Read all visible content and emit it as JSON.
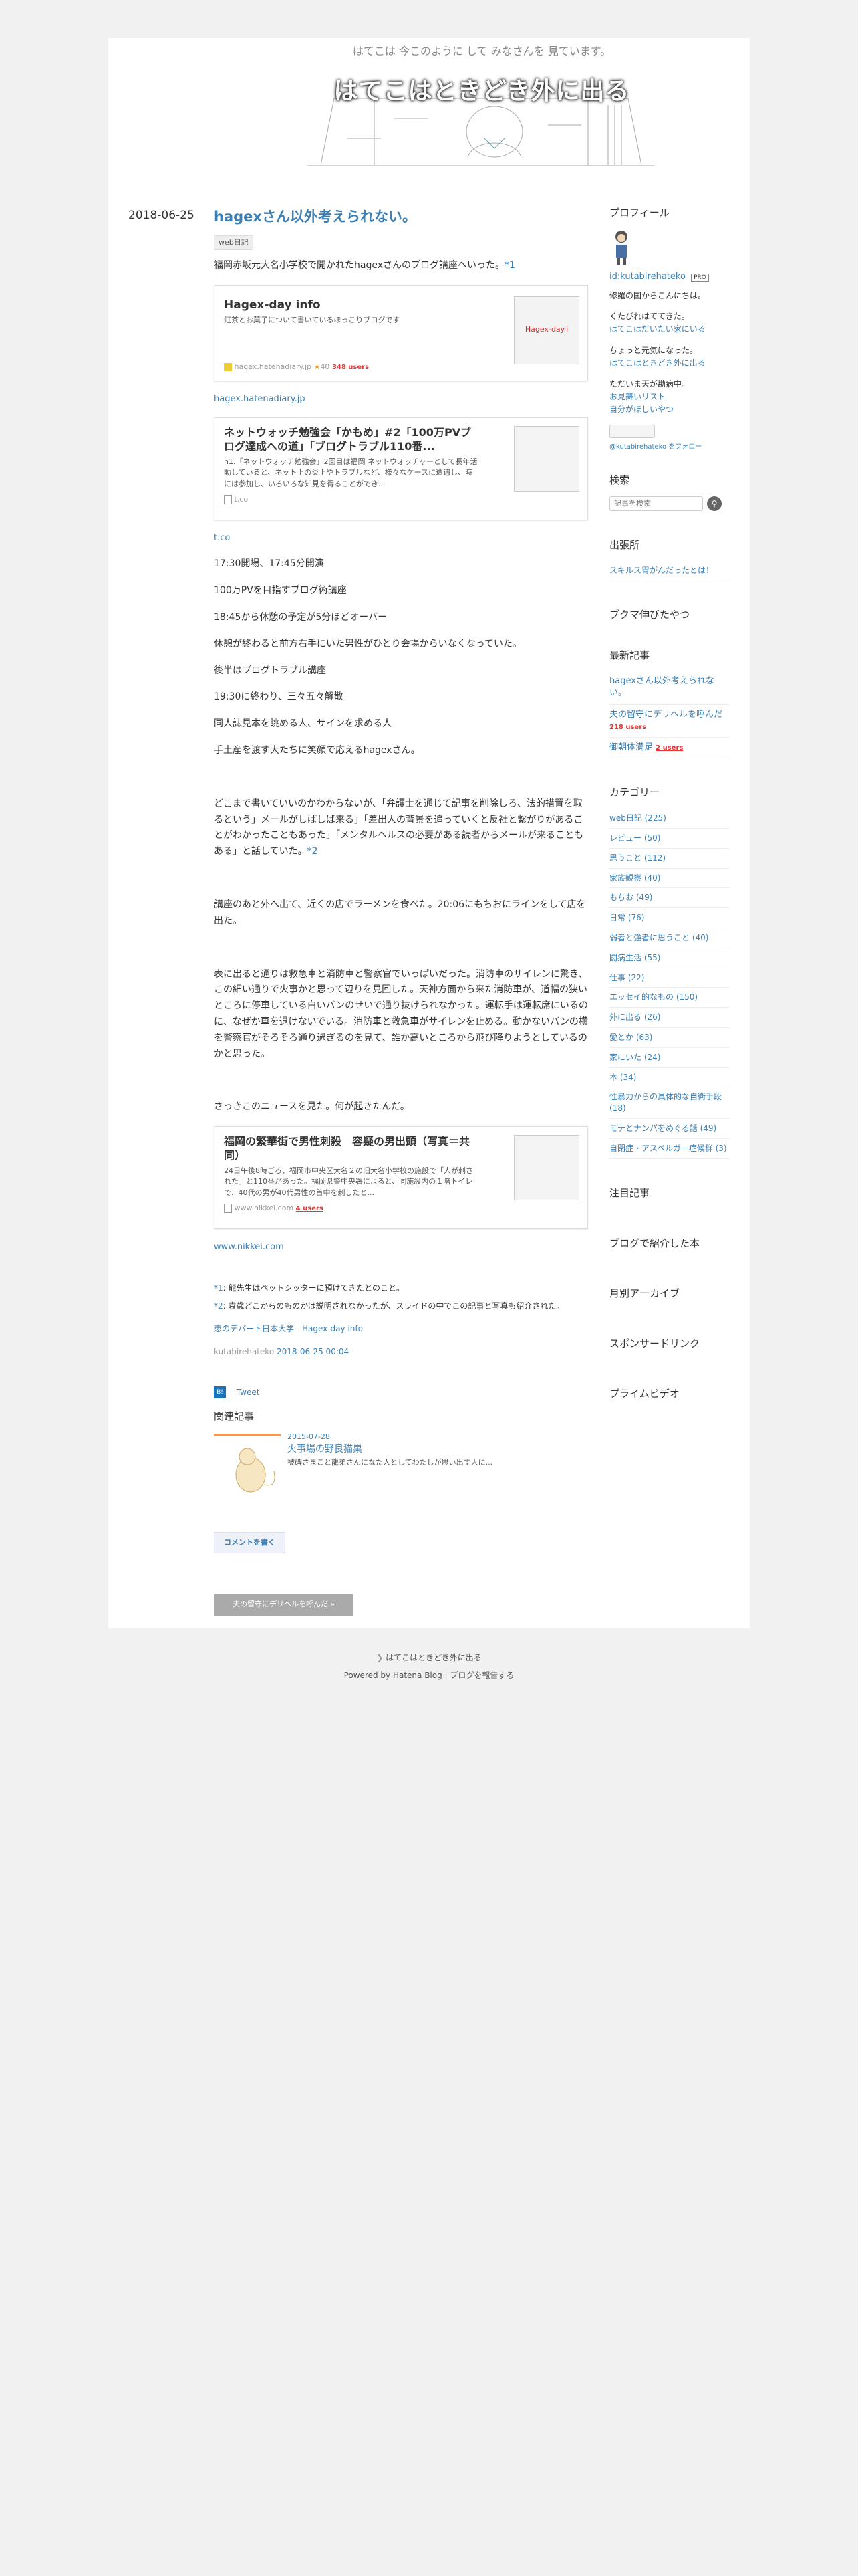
{
  "blog": {
    "title": "はてこはときどき外に出る",
    "tagline": "はてこは 今このように して みなさんを 見ています。"
  },
  "entry": {
    "date": "2018-06-25",
    "title": "hagexさん以外考えられない。",
    "tag": "web日記",
    "intro": "福岡赤坂元大名小学校で開かれたhagexさんのブログ講座へいった。",
    "fn1_mark": "*1",
    "card1": {
      "title": "Hagex-day info",
      "desc": "虹茶とお菓子について書いているほっこりブログです",
      "thumb_label": "Hagex-day.i",
      "meta_site": "hagex.hatenadiary.jp",
      "meta_count": "40",
      "users": "348 users"
    },
    "card1_link": "hagex.hatenadiary.jp",
    "card2": {
      "title": "ネットウォッチ勉強会「かもめ」#2「100万PVブログ達成への道」「ブログトラブル110番...",
      "desc": "h1.「ネットウォッチ勉強会」2回目は福岡 ネットウォッチャーとして長年活動していると、ネット上の炎上やトラブルなど、様々なケースに遭遇し、時には参加し、いろいろな知見を得ることができ...",
      "meta_site": "t.co"
    },
    "card2_link": "t.co",
    "schedule": [
      "17:30開場、17:45分開演",
      "100万PVを目指すブログ術講座",
      "18:45から休憩の予定が5分ほどオーバー",
      "休憩が終わると前方右手にいた男性がひとり会場からいなくなっていた。",
      "後半はブログトラブル講座",
      "19:30に終わり、三々五々解散",
      "同人誌見本を眺める人、サインを求める人",
      "手土産を渡す大たちに笑顔で応えるhagexさん。"
    ],
    "para2": "どこまで書いていいのかわからないが、「弁護士を通じて記事を削除しろ、法的措置を取るという」メールがしばしば来る」「差出人の背景を追っていくと反社と繋がりがあることがわかったこともあった」「メンタルヘルスの必要がある読者からメールが来ることもある」と話していた。",
    "fn2_mark": "*2",
    "para3": "講座のあと外へ出て、近くの店でラーメンを食べた。20:06にもちおにラインをして店を出た。",
    "para4": "表に出ると通りは救急車と消防車と警察官でいっぱいだった。消防車のサイレンに驚き、この細い通りで火事かと思って辺りを見回した。天神方面から来た消防車が、道幅の狭いところに停車している白いバンのせいで通り抜けられなかった。運転手は運転席にいるのに、なぜか車を退けないでいる。消防車と救急車がサイレンを止める。動かないバンの横を警察官がそろそろ通り過ぎるのを見て、誰か高いところから飛び降りようとしているのかと思った。",
    "para5": "さっきこのニュースを見た。何が起きたんだ。",
    "card3": {
      "title": "福岡の繁華街で男性刺殺　容疑の男出頭（写真＝共同）",
      "desc": "24日午後8時ごろ、福岡市中央区大名２の旧大名小学校の施設で「人が刺された」と110番があった。福岡県警中央署によると、同施設内の１階トイレで、40代の男が40代男性の首中を刺したと...",
      "meta_site": "www.nikkei.com",
      "users": "4 users"
    },
    "card3_link": "www.nikkei.com",
    "footnotes": [
      {
        "mark": "*1",
        "text": ": 龍先生はペットシッターに預けてきたとのこと。"
      },
      {
        "mark": "*2",
        "text": ": 袁歳どこからのものかは説明されなかったが、スライドの中でこの記事と写真も紹介された。"
      }
    ],
    "quote_source": "恵のデパート日本大学 - Hagex-day info",
    "author": "kutabirehateko",
    "timestamp": "2018-06-25 00:04",
    "tweet": "Tweet",
    "related_heading": "関連記事",
    "related": {
      "date": "2015-07-28",
      "title": "火事場の野良猫巣",
      "desc": "被碑さまこと龍弟さんになた人としてわたしが思い出す人に..."
    },
    "comment_button": "コメントを書く",
    "pager_label": "夫の留守にデリヘルを呼んだ »"
  },
  "sidebar": {
    "profile": {
      "title": "プロフィール",
      "id": "id:kutabirehateko",
      "pro": "PRO",
      "lines": [
        "修羅の国からこんにちは。",
        "くたびれはててきた。"
      ],
      "link1": "はてこはだいたい家にいる",
      "line3": "ちょっと元気になった。",
      "link2": "はてこはときどき外に出る",
      "line4": "ただいま天が勘病中。",
      "link3": "お見舞いリスト",
      "link4": "自分がほしいやつ",
      "follow": "@kutabirehateko をフォロー"
    },
    "search": {
      "title": "検索",
      "placeholder": "記事を検索"
    },
    "belong": {
      "title": "出張所",
      "link": "スキルス胃がんだったとは！"
    },
    "bukuma": {
      "title": "ブクマ伸びたやつ"
    },
    "recent": {
      "title": "最新記事",
      "items": [
        {
          "label": "hagexさん以外考えられない。",
          "users": ""
        },
        {
          "label": "夫の留守にデリヘルを呼んだ",
          "users": "218 users"
        },
        {
          "label": "御朝体満足",
          "users": "2 users"
        }
      ]
    },
    "categories": {
      "title": "カテゴリー",
      "items": [
        "web日記 (225)",
        "レビュー (50)",
        "思うこと (112)",
        "家族観察 (40)",
        "もちお (49)",
        "日常 (76)",
        "弱者と強者に思うこと (40)",
        "闘病生活 (55)",
        "仕事 (22)",
        "エッセイ的なもの (150)",
        "外に出る (26)",
        "愛とか (63)",
        "家にいた (24)",
        "本 (34)",
        "性暴力からの具体的な自衛手段 (18)",
        "モテとナンパをめぐる話 (49)",
        "自閉症・アスペルガー症候群 (3)"
      ]
    },
    "chumoku": {
      "title": "注目記事"
    },
    "introduced": {
      "title": "ブログで紹介した本"
    },
    "archive": {
      "title": "月別アーカイブ"
    },
    "sponsored": {
      "title": "スポンサードリンク"
    },
    "prime": {
      "title": "プライムビデオ"
    }
  },
  "footer": {
    "blog_name": "はてこはときどき外に出る",
    "powered": "Powered by Hatena Blog | ブログを報告する"
  }
}
